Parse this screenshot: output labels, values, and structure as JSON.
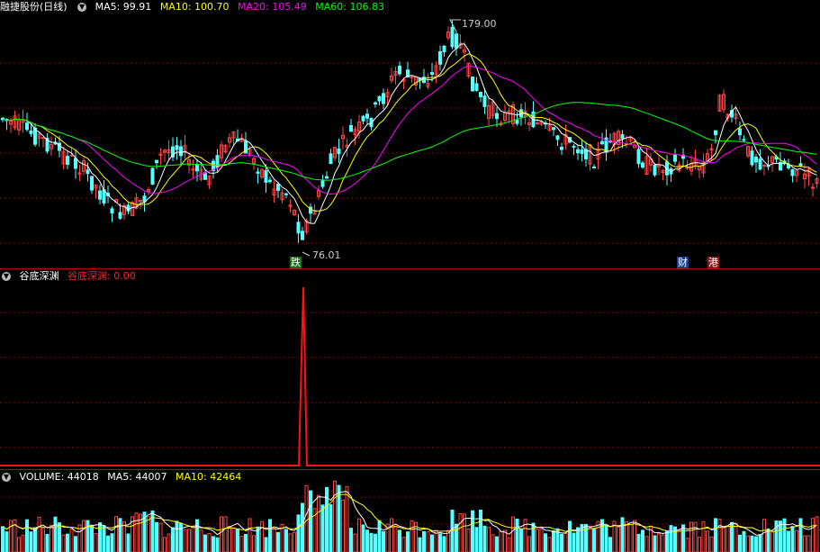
{
  "kline": {
    "stock_name": "融捷股份(日线)",
    "ma_labels": [
      {
        "text": "MA5: 99.91",
        "color": "#ffffff"
      },
      {
        "text": "MA10: 100.70",
        "color": "#ffff00"
      },
      {
        "text": "MA20: 105.49",
        "color": "#ff00ff"
      },
      {
        "text": "MA60: 106.83",
        "color": "#00ff00"
      }
    ],
    "high_label": "179.00",
    "low_label": "76.01",
    "tags": [
      {
        "text": "跌",
        "bg": "#1a6b1a",
        "color": "#ffffff"
      },
      {
        "text": "财",
        "bg": "#1a3b8a",
        "color": "#ffffff"
      },
      {
        "text": "港",
        "bg": "#8a1a1a",
        "color": "#ffffff"
      }
    ]
  },
  "indicator": {
    "name": "谷底深渊",
    "value_label": "谷底深渊: 0.00",
    "value_color": "#ff2222"
  },
  "volume": {
    "labels": [
      {
        "text": "VOLUME: 44018",
        "color": "#ffffff"
      },
      {
        "text": "MA5: 44007",
        "color": "#ffffff"
      },
      {
        "text": "MA10: 42464",
        "color": "#ffff00"
      }
    ]
  },
  "colors": {
    "up": "#ff4444",
    "down": "#55ffff",
    "ma5": "#ffffff",
    "ma10": "#ffff00",
    "ma20": "#ff00ff",
    "ma60": "#00ff00",
    "grid": "#8b0000"
  }
}
